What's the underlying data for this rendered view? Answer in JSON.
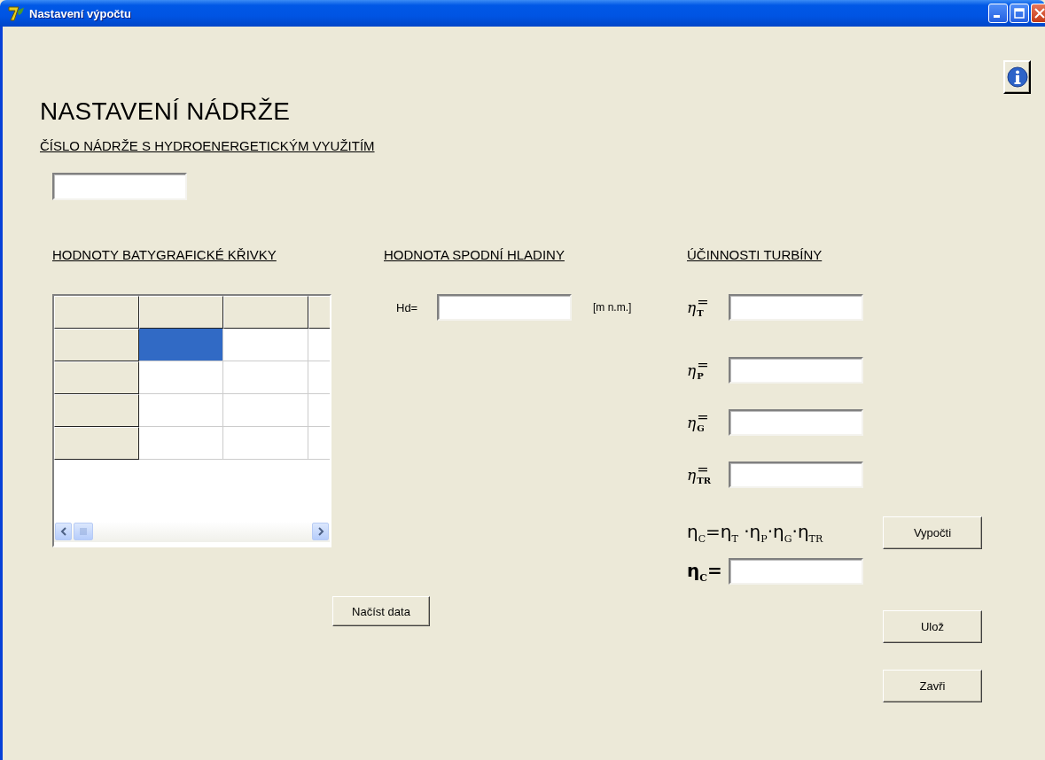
{
  "window": {
    "title": "Nastavení výpočtu"
  },
  "heading": "NASTAVENÍ NÁDRŽE",
  "tank_number": {
    "label": "ČÍSLO NÁDRŽE S HYDROENERGETICKÝM VYUŽITÍM"
  },
  "bathymetric": {
    "label": "HODNOTY BATYGRAFICKÉ KŘIVKY",
    "grid": {
      "rows": [
        {
          "cells": [
            {
              "selected": true
            },
            {
              "selected": false
            },
            {
              "selected": false
            }
          ]
        },
        {
          "cells": [
            {
              "selected": false
            },
            {
              "selected": false
            },
            {
              "selected": false
            }
          ]
        },
        {
          "cells": [
            {
              "selected": false
            },
            {
              "selected": false
            },
            {
              "selected": false
            }
          ]
        },
        {
          "cells": [
            {
              "selected": false
            },
            {
              "selected": false
            },
            {
              "selected": false
            }
          ]
        }
      ]
    },
    "load_button": "Načíst data"
  },
  "lower_level": {
    "label": "HODNOTA SPODNÍ HLADINY",
    "field_label": "Hd=",
    "unit": "[m n.m.]"
  },
  "efficiency": {
    "label": "ÚČINNOSTI TURBÍNY",
    "fields": [
      {
        "symbol": "η",
        "subscript": "T",
        "sign": "="
      },
      {
        "symbol": "η",
        "subscript": "P",
        "sign": "="
      },
      {
        "symbol": "η",
        "subscript": "G",
        "sign": "="
      },
      {
        "symbol": "η",
        "subscript": "TR",
        "sign": "="
      }
    ],
    "formula": "η$_{C}$=η$_{T}$ ·η$_{P}$·η$_{G}$·η$_{TR}$",
    "compute_button": "Vypočti",
    "result_label": "η$_{C}$="
  },
  "buttons": [
    "Ulož",
    "Zavři"
  ]
}
